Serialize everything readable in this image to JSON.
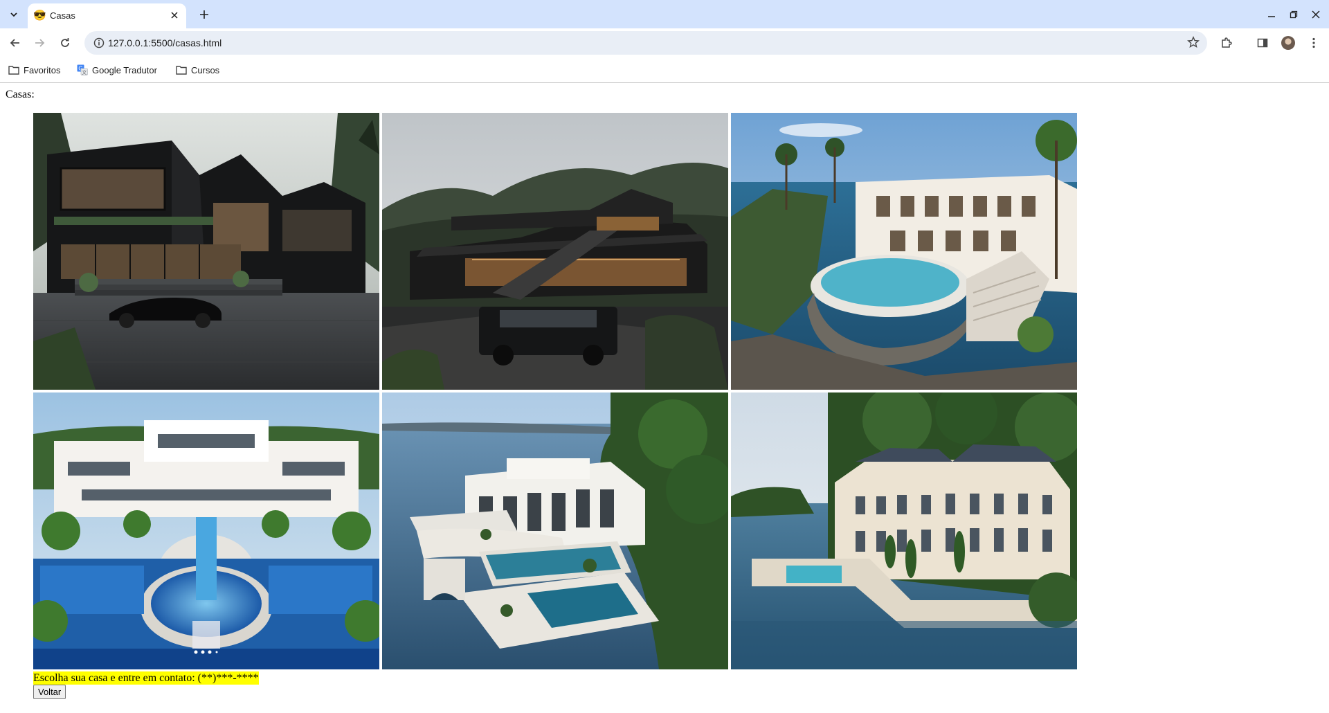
{
  "browser": {
    "tab_title": "Casas",
    "tab_favicon": "😎",
    "url": "127.0.0.1:5500/casas.html",
    "bookmarks": [
      {
        "label": "Favoritos",
        "icon": "folder-icon"
      },
      {
        "label": "Google Tradutor",
        "icon": "translate-icon"
      },
      {
        "label": "Cursos",
        "icon": "folder-icon"
      }
    ]
  },
  "page": {
    "heading": "Casas:",
    "houses": [
      {
        "name": "black-modern-house-with-car"
      },
      {
        "name": "mountain-house-with-suv"
      },
      {
        "name": "cliff-villa-with-infinity-pool"
      },
      {
        "name": "white-resort-mansion-with-pools"
      },
      {
        "name": "lakeside-white-villa"
      },
      {
        "name": "waterfront-chateau"
      }
    ],
    "contact_text": "Escolha sua casa e entre em contato: (**)***-****",
    "back_label": "Voltar"
  },
  "colors": {
    "tabstrip": "#d3e3fd",
    "omnibox": "#e9eef6",
    "highlight": "#ffff00"
  }
}
